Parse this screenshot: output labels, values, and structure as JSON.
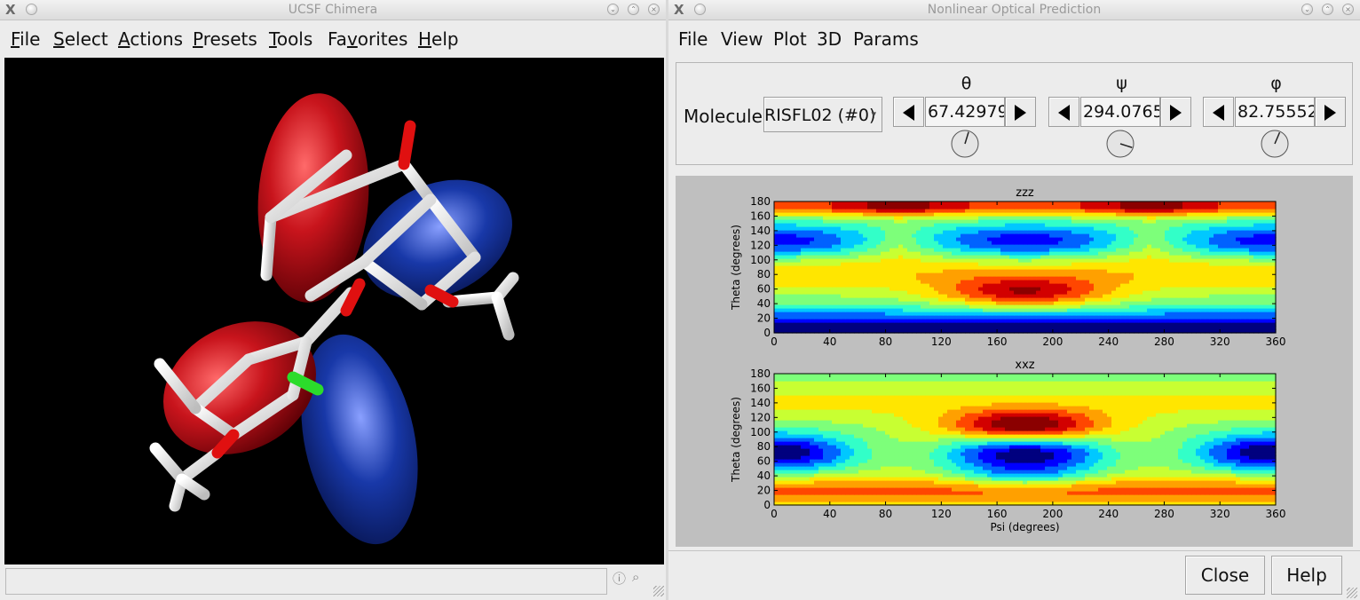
{
  "left_window": {
    "title": "UCSF Chimera",
    "menu": [
      {
        "label": "File",
        "mnemonic": "F",
        "rest": "ile"
      },
      {
        "label": "Select",
        "mnemonic": "S",
        "rest": "elect"
      },
      {
        "label": "Actions",
        "mnemonic": "A",
        "rest": "ctions"
      },
      {
        "label": "Presets",
        "mnemonic": "P",
        "rest": "resets"
      },
      {
        "label": "Tools",
        "mnemonic": "T",
        "rest": "ools"
      },
      {
        "label": "Favorites",
        "pre": "Fa",
        "mnemonic": "v",
        "rest": "orites"
      },
      {
        "label": "Help",
        "mnemonic": "H",
        "rest": "elp"
      }
    ],
    "status_text": ""
  },
  "right_window": {
    "title": "Nonlinear Optical Prediction",
    "menu": [
      "File",
      "View",
      "Plot",
      "3D",
      "Params"
    ],
    "molecule_label": "Molecule",
    "molecule_value": "RISFL02 (#0)",
    "angles": [
      {
        "symbol": "θ",
        "value": "67.42979",
        "dial_deg": 67.43
      },
      {
        "symbol": "ψ",
        "value": "294.0765",
        "dial_deg": 294.08
      },
      {
        "symbol": "φ",
        "value": "82.75552",
        "dial_deg": 82.76
      }
    ],
    "buttons": {
      "close": "Close",
      "help": "Help"
    }
  },
  "chart_data": [
    {
      "type": "contour",
      "title": "zzz",
      "xlabel": "",
      "ylabel": "Theta (degrees)",
      "xlim": [
        0,
        360
      ],
      "ylim": [
        0,
        180
      ],
      "xticks": [
        0,
        40,
        80,
        120,
        160,
        200,
        240,
        280,
        320,
        360
      ],
      "yticks": [
        0,
        20,
        40,
        60,
        80,
        100,
        120,
        140,
        160,
        180
      ],
      "colormap": "jet",
      "max_regions": [
        {
          "x": 180,
          "y": 175
        },
        {
          "x": 180,
          "y": 55
        }
      ],
      "min_regions": [
        {
          "x": 0,
          "y": 125
        },
        {
          "x": 360,
          "y": 125
        },
        {
          "x": 180,
          "y": 10
        }
      ]
    },
    {
      "type": "contour",
      "title": "xxz",
      "xlabel": "Psi (degrees)",
      "ylabel": "Theta (degrees)",
      "xlim": [
        0,
        360
      ],
      "ylim": [
        0,
        180
      ],
      "xticks": [
        0,
        40,
        80,
        120,
        160,
        200,
        240,
        280,
        320,
        360
      ],
      "yticks": [
        0,
        20,
        40,
        60,
        80,
        100,
        120,
        140,
        160,
        180
      ],
      "colormap": "jet",
      "max_regions": [
        {
          "x": 180,
          "y": 108
        }
      ],
      "min_regions": [
        {
          "x": 0,
          "y": 72
        },
        {
          "x": 360,
          "y": 72
        }
      ]
    }
  ],
  "colors": {
    "window_bg": "#ececec",
    "plot_bg": "#bfbfbf",
    "viewport_bg": "#000000",
    "orbital_red": "#c8141c",
    "orbital_blue": "#1838a8",
    "jet": [
      "#00007f",
      "#0000ff",
      "#0062ff",
      "#00c8ff",
      "#32ffc8",
      "#7dff7a",
      "#c8ff32",
      "#ffe600",
      "#ffa000",
      "#ff4600",
      "#d20000",
      "#8b0000"
    ]
  }
}
